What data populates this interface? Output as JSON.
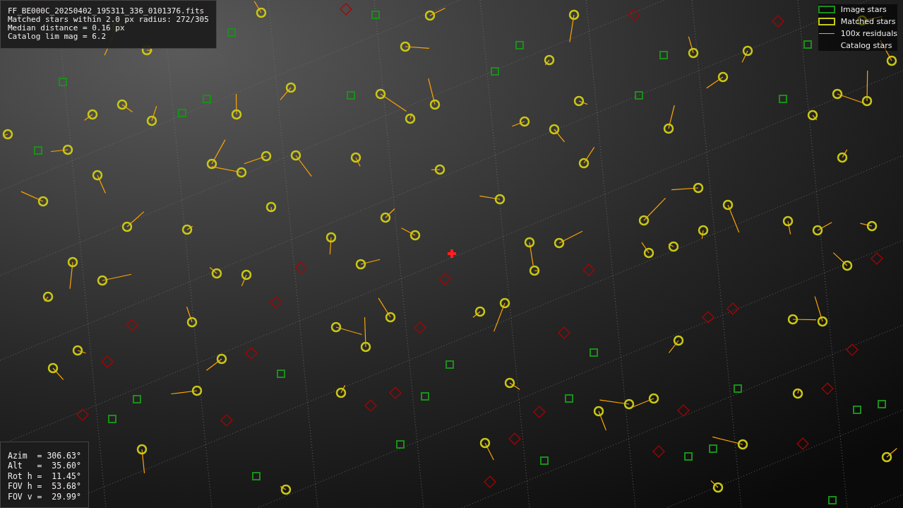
{
  "info_panel": {
    "lines": [
      "FF_BE000C_20250402_195311_336_0101376.fits",
      "Matched stars within 2.0 px radius: 272/305",
      "Median distance = 0.16 px",
      "Catalog lim mag = 6.2"
    ]
  },
  "legend": [
    {
      "label": "Image stars",
      "kind": "image"
    },
    {
      "label": "Matched stars",
      "kind": "matched"
    },
    {
      "label": "100x residuals",
      "kind": "residual"
    },
    {
      "label": "Catalog stars",
      "kind": "catalog"
    }
  ],
  "pointing_panel": {
    "lines": [
      "Azim  = 306.63°",
      "Alt   =  35.60°",
      "Rot h =  11.45°",
      "FOV h =  53.68°",
      "FOV v =  29.99°"
    ]
  }
}
